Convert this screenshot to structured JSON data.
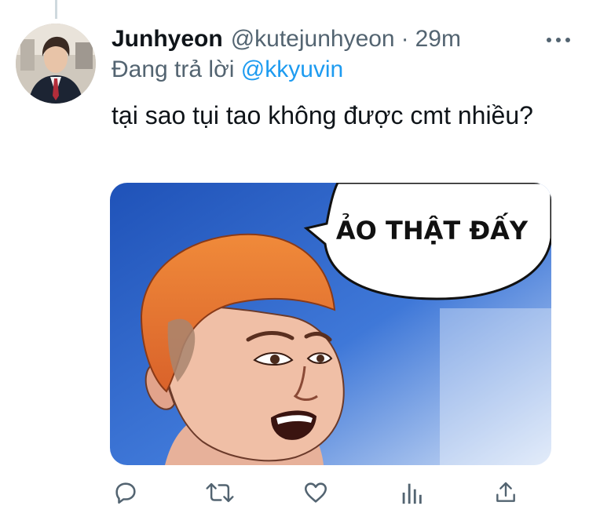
{
  "tweet": {
    "author_name": "Junhyeon",
    "handle": "@kutejunhyeon",
    "separator": "·",
    "time": "29m",
    "reply_prefix": "Đang trả lời",
    "reply_mention": "@kkyuvin",
    "text": "tại sao tụi tao không được cmt nhiều?"
  },
  "media": {
    "speech_bubble_text": "ẢO THẬT ĐẤY"
  },
  "actions": [
    {
      "icon": "reply-icon"
    },
    {
      "icon": "retweet-icon"
    },
    {
      "icon": "like-icon"
    },
    {
      "icon": "analytics-icon"
    },
    {
      "icon": "share-icon"
    }
  ],
  "colors": {
    "accent": "#1d9bf0",
    "secondary_text": "#536471",
    "primary_text": "#0f1419"
  }
}
